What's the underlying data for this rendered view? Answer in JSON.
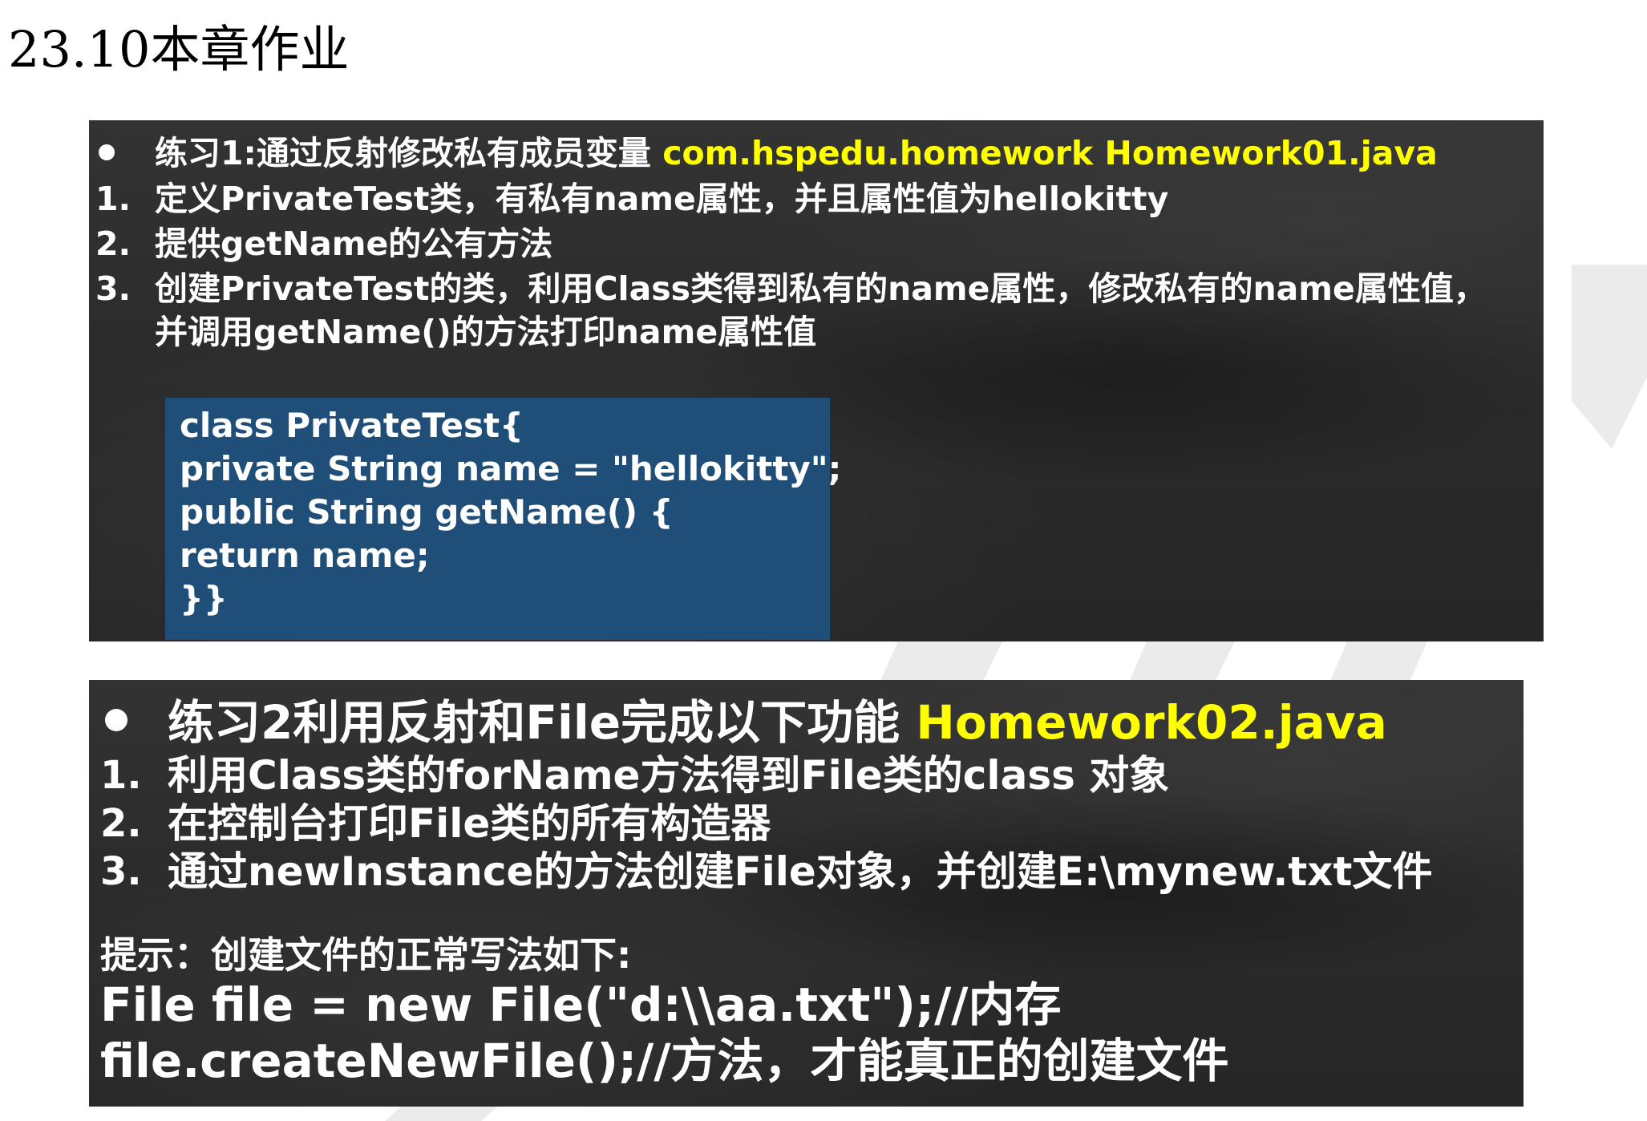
{
  "page": {
    "title": "23.10本章作业"
  },
  "exercise1": {
    "heading_text": "练习1:通过反射修改私有成员变量 ",
    "heading_path": "com.hspedu.homework  Homework01.java",
    "items": [
      {
        "num": "1.",
        "text": "定义PrivateTest类，有私有name属性，并且属性值为hellokitty"
      },
      {
        "num": "2.",
        "text": "提供getName的公有方法"
      },
      {
        "num": "3.",
        "text": "创建PrivateTest的类，利用Class类得到私有的name属性，修改私有的name属性值，"
      }
    ],
    "item3_continued": "并调用getName()的方法打印name属性值",
    "code_lines": [
      "class PrivateTest{",
      "private String name = \"hellokitty\";",
      "public String getName() {",
      "return name;",
      "}}"
    ]
  },
  "exercise2": {
    "heading_text": "练习2利用反射和File完成以下功能 ",
    "heading_file": "Homework02.java",
    "items": [
      {
        "num": "1.",
        "text": "利用Class类的forName方法得到File类的class 对象"
      },
      {
        "num": "2.",
        "text": "在控制台打印File类的所有构造器"
      },
      {
        "num": "3.",
        "text": "通过newInstance的方法创建File对象，并创建E:\\mynew.txt文件"
      }
    ],
    "hint": "提示：创建文件的正常写法如下:",
    "code_lines": [
      "File file = new File(\"d:\\\\aa.txt\");//内存",
      "file.createNewFile();//方法，才能真正的创建文件"
    ]
  },
  "colors": {
    "board_background": "#2e2e2e",
    "code_box_background": "#1f4e79",
    "highlight": "#ffff00",
    "text": "#ffffff"
  }
}
